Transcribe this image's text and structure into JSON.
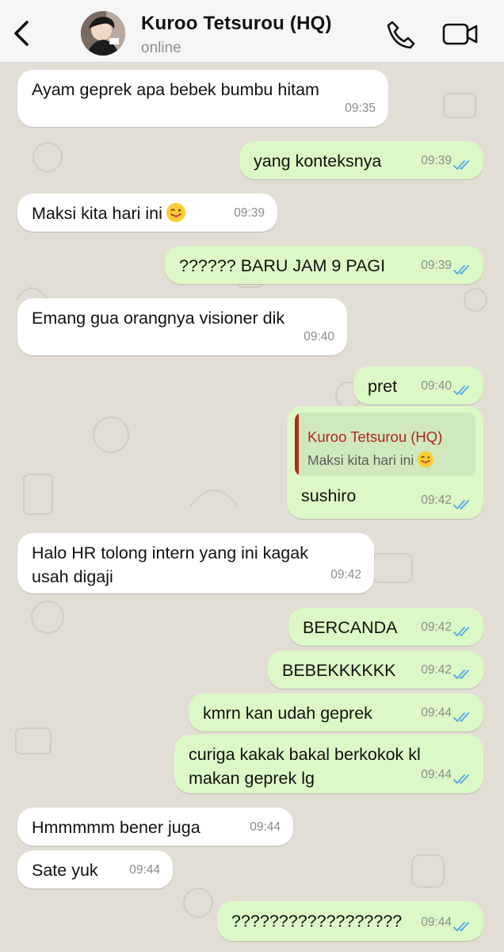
{
  "header": {
    "contact_name": "Kuroo Tetsurou (HQ)",
    "status": "online"
  },
  "colors": {
    "incoming_bubble": "#ffffff",
    "outgoing_bubble": "#dcf8c6",
    "read_ticks": "#4fa6e8",
    "quote_accent": "#b0291d"
  },
  "messages": [
    {
      "dir": "in",
      "text": "Ayam geprek apa bebek bumbu hitam",
      "time": "09:35"
    },
    {
      "dir": "out",
      "text": "yang konteksnya",
      "time": "09:39"
    },
    {
      "dir": "in",
      "text": "Maksi kita hari ini",
      "emoji": "tongue-out-emoji",
      "time": "09:39"
    },
    {
      "dir": "out",
      "text": "?????? BARU JAM 9 PAGI",
      "time": "09:39"
    },
    {
      "dir": "in",
      "text": "Emang gua orangnya visioner dik",
      "time": "09:40"
    },
    {
      "dir": "out",
      "text": "pret",
      "time": "09:40"
    },
    {
      "dir": "out",
      "text": "sushiro",
      "time": "09:42",
      "quote": {
        "name": "Kuroo Tetsurou (HQ)",
        "text": "Maksi kita hari ini",
        "emoji": "tongue-out-emoji"
      }
    },
    {
      "dir": "in",
      "text": "Halo HR tolong intern yang ini kagak\nusah digaji",
      "time": "09:42"
    },
    {
      "dir": "out",
      "text": "BERCANDA",
      "time": "09:42"
    },
    {
      "dir": "out",
      "text": "BEBEKKKKKK",
      "time": "09:42"
    },
    {
      "dir": "out",
      "text": "kmrn kan udah geprek",
      "time": "09:44"
    },
    {
      "dir": "out",
      "text": "curiga kakak bakal berkokok kl\nmakan geprek lg",
      "time": "09:44"
    },
    {
      "dir": "in",
      "text": "Hmmmmm bener juga",
      "time": "09:44"
    },
    {
      "dir": "in",
      "text": "Sate yuk",
      "time": "09:44"
    },
    {
      "dir": "out",
      "text": "??????????????????",
      "time": "09:44"
    }
  ]
}
